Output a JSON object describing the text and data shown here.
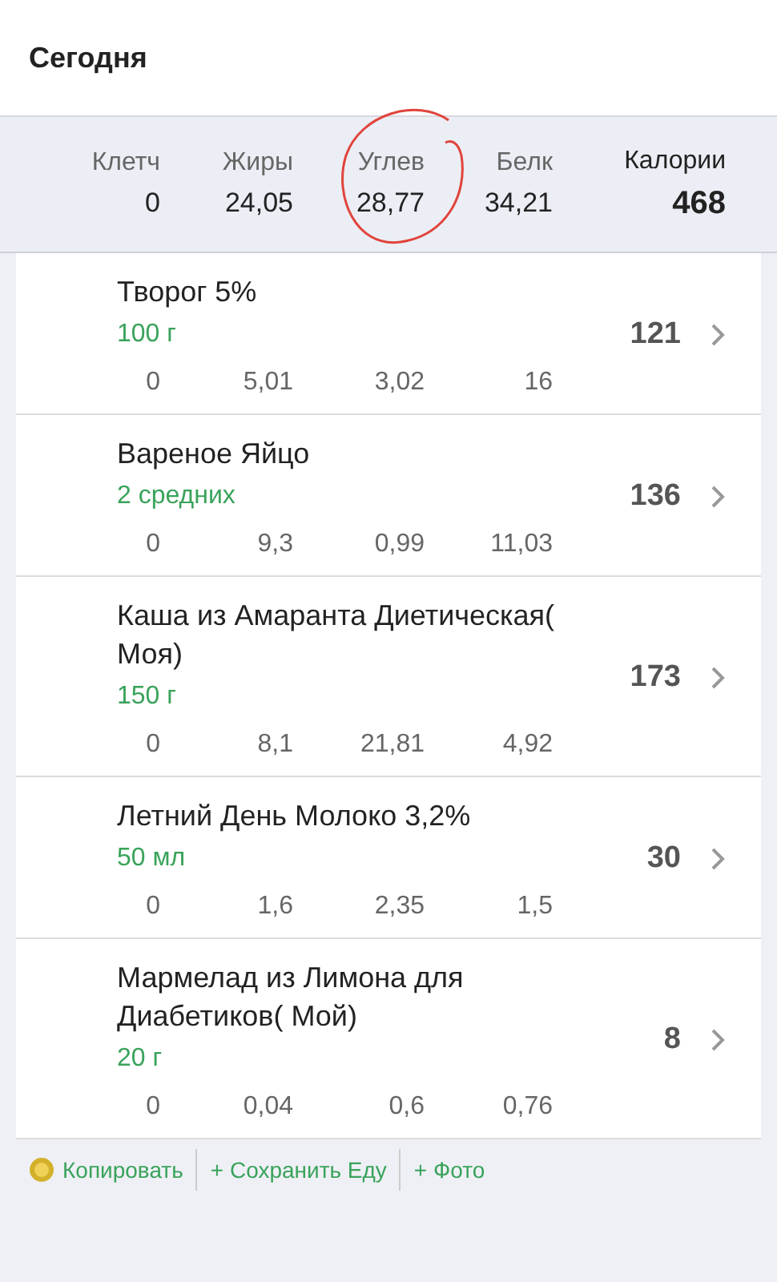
{
  "header": {
    "title": "Сегодня"
  },
  "summary": {
    "columns": [
      {
        "label": "Клетч",
        "value": "0"
      },
      {
        "label": "Жиры",
        "value": "24,05"
      },
      {
        "label": "Углев",
        "value": "28,77"
      },
      {
        "label": "Белк",
        "value": "34,21"
      }
    ],
    "total": {
      "label": "Калории",
      "value": "468"
    },
    "annotation": {
      "kind": "circle",
      "color": "#e0443c"
    }
  },
  "entries": [
    {
      "name": "Творог 5%",
      "amount": "100 г",
      "calories": "121",
      "macros": [
        "0",
        "5,01",
        "3,02",
        "16"
      ]
    },
    {
      "name": "Вареное Яйцо",
      "amount": "2 средних",
      "calories": "136",
      "macros": [
        "0",
        "9,3",
        "0,99",
        "11,03"
      ]
    },
    {
      "name": "Каша из Амаранта Диетическая( Моя)",
      "amount": "150 г",
      "calories": "173",
      "macros": [
        "0",
        "8,1",
        "21,81",
        "4,92"
      ]
    },
    {
      "name": "Летний День Молоко 3,2%",
      "amount": "50 мл",
      "calories": "30",
      "macros": [
        "0",
        "1,6",
        "2,35",
        "1,5"
      ]
    },
    {
      "name": "Мармелад из Лимона для Диабетиков( Мой)",
      "amount": "20 г",
      "calories": "8",
      "macros": [
        "0",
        "0,04",
        "0,6",
        "0,76"
      ]
    }
  ],
  "toolbar": [
    {
      "kind": "coin",
      "label": "Копировать"
    },
    {
      "kind": "plain",
      "label": "+ Сохранить Еду"
    },
    {
      "kind": "plain",
      "label": "+ Фото"
    }
  ]
}
